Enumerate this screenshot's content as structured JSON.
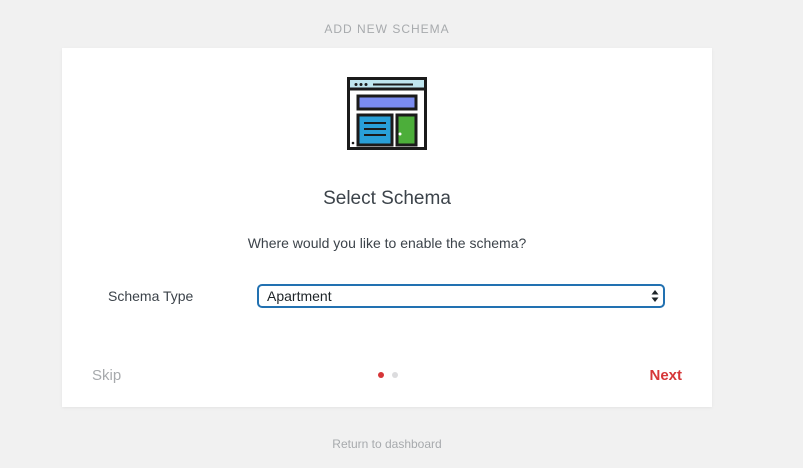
{
  "header": {
    "title": "ADD NEW SCHEMA"
  },
  "card": {
    "heading": "Select Schema",
    "subtitle": "Where would you like to enable the schema?",
    "field": {
      "label": "Schema Type",
      "value": "Apartment"
    },
    "pagination": {
      "current": 1,
      "total": 2
    },
    "skip_label": "Skip",
    "next_label": "Next"
  },
  "footer": {
    "return_link": "Return to dashboard"
  },
  "colors": {
    "accent": "#d63638",
    "focus": "#2271b1",
    "muted": "#a7aaad"
  },
  "icons": {
    "illustration": "webpage-layout-icon",
    "select_arrows": "updown-arrows-icon"
  }
}
